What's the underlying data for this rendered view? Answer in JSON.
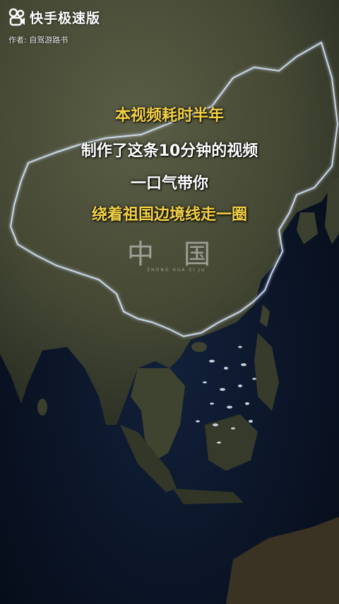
{
  "watermark": {
    "brand": "快手极速版",
    "author": "作者: 自驾游路书"
  },
  "captions": {
    "line1": "本视频耗时半年",
    "line2": "制作了这条10分钟的视频",
    "line3": "一口气带你",
    "line4": "绕着祖国边境线走一圈"
  },
  "map": {
    "country_label": "中国",
    "pinyin_label": "ZHONG HUA ZI JU"
  },
  "colors": {
    "caption_accent": "#f2d046",
    "caption_main": "#ffffff",
    "ocean": "#0a1424",
    "land": "#4b5138",
    "border_glow": "#cfe3ff"
  }
}
